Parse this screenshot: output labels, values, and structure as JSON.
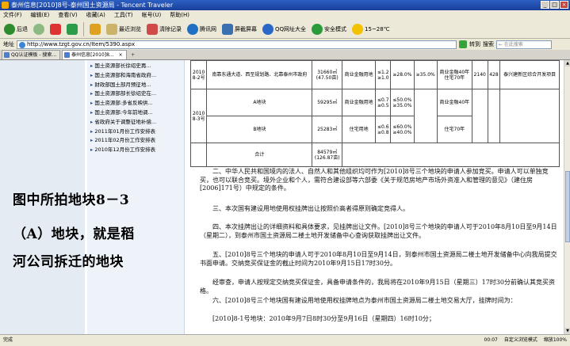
{
  "window": {
    "title": "泰州信息[2010]8号-泰州国土资源局 - Tencent Traveler"
  },
  "menu": [
    "文件(F)",
    "编辑(E)",
    "查看(V)",
    "收藏(A)",
    "工具(T)",
    "帐号(U)",
    "帮助(H)"
  ],
  "toolbar": {
    "back": "后退",
    "recent": "最近浏览",
    "clear_history": "清除记录",
    "weibo": "腾讯网",
    "screenshot": "屏截屏幕",
    "qq_site": "QQ网址大全",
    "safe": "安全模式",
    "weather": "15~28℃"
  },
  "address": {
    "label": "地址",
    "url": "http://www.tzgt.gov.cn/Item/5390.aspx",
    "go": "转到",
    "search_label": "搜索",
    "search_placeholder": "← 在此搜索"
  },
  "tabs": [
    {
      "label": "QQ认证模板 - 搜索...",
      "active": false
    },
    {
      "label": "泰州信息[2010]8...",
      "active": true
    }
  ],
  "sidebar": {
    "items": [
      "国土资源部长徐绍史再...",
      "国土资源部和海南省政府...",
      "财政部国土部月预征地...",
      "国土资源部部长徐绍史在...",
      "国土资源部:多省反映供...",
      "国土资源部:今年前地调...",
      "省政府关于调整征地补偿...",
      "2011年01月份工作安排表",
      "2011年02月份工作安排表",
      "2010年12月份工作安排表"
    ]
  },
  "caption": [
    "图中所拍地块8－3",
    "（A）地块，就是稻",
    "河公司拆迁的地块"
  ],
  "table": {
    "row1": [
      "2010\n8-2号",
      "南靠东通大道、西至规划路、北靠泰州市政府",
      "31660㎡\n(47.50亩)",
      "商业金融用地",
      "≤1.2\n≥1.0",
      "≥28.0%",
      "≥35.0%",
      "商业金融40年\n住宅70年",
      "2140",
      "428",
      "泰兴建新区综合开发项目"
    ],
    "row2": [
      "2010\n8-3号",
      "A地块",
      "59295㎡",
      "商业金融用地",
      "≤0.7\n≥0.5",
      "≤50.0%\n≥35.0%",
      "",
      "商业金融40年",
      "",
      "",
      ""
    ],
    "row3": [
      "",
      "B地块",
      "25283㎡",
      "住宅用地",
      "≤0.6\n≥0.8",
      "≤60.0%\n≥40.0%",
      "≥35.0%",
      "住宅70年",
      "56880",
      "1138",
      "泰兴建新区资源整合项目"
    ],
    "row4": [
      "",
      "合计",
      "84579㎡\n(126.87亩)",
      "",
      "",
      "",
      "",
      "",
      "",
      "",
      ""
    ]
  },
  "paragraphs": [
    "二、中华人民共和国境内的法人、自然人和其他组织均可作为[2010]8号三个地块的申请人参加竞买。申请人可以单独竞买，也可以联合竞买。境外企业和个人，需符合建设部等六部委《关于规范房地产市场外资准入和管理的意见》（建住房[2006]171号）中规定的条件。",
    "三、本次国有建设用地使用权挂牌出让按照价高者得原则确定竞得人。",
    "四、本次挂牌出让的详细资料和具体要求，见挂牌出让文件。[2010]8号三个地块的申请人可于2010年8月10日至9月14日（星期二），到泰州市国土资源局二楼土地开发储备中心查询获取挂牌出让文件。",
    "五、[2010]8号三个地块的申请人可于2010年8月10日至9月14日，到泰州市国土资源局二楼土地开发储备中心向我局提交书面申请。交纳竞买保证金的截止时间为2010年9月15日17时30分。",
    "经审查，申请人按规定交纳竞买保证金，具备申请条件的，我局将在2010年9月15日（星期三）17时30分前确认其竞买资格。",
    "六、[2010]8号三个地块国有建设用地使用权挂牌地点为泰州市国土资源局二楼土地交易大厅，挂牌时间为：",
    "[2010]8-1号地块：2010年9月7日8时30分至9月16日（星期四）16时10分；"
  ],
  "status": {
    "left": "完成",
    "time": "00:07",
    "mode": "自定义浏览模式",
    "zoom": "缩放100%"
  },
  "colors": {
    "title_bar": "#2b5fc2",
    "chrome": "#ece9d8",
    "sidebar_bg": "#eef3f9"
  }
}
